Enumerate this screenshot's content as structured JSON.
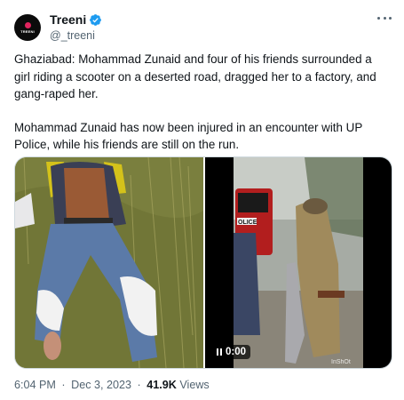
{
  "author": {
    "name": "Treeni",
    "handle": "@_treeni",
    "avatar_text": "TREENI",
    "verified_color": "#1d9bf0"
  },
  "tweet": {
    "paragraphs": [
      "Ghaziabad: Mohammad Zunaid and four of his friends surrounded a girl riding a scooter on a deserted road, dragged her to a factory, and gang-raped her.",
      "Mohammad Zunaid has now been injured in an encounter with UP Police, while his friends are still on the run."
    ]
  },
  "media": {
    "video_time": "0:00",
    "left_image_icon": "photo",
    "right_video_icon": "pause-icon",
    "watermark": "InShOt"
  },
  "meta": {
    "time": "6:04 PM",
    "separator": "·",
    "date": "Dec 3, 2023",
    "views_count": "41.9K",
    "views_label": "Views"
  },
  "colors": {
    "text": "#0f1419",
    "secondary": "#536471",
    "border": "#cfd9de",
    "verified": "#1d9bf0"
  }
}
